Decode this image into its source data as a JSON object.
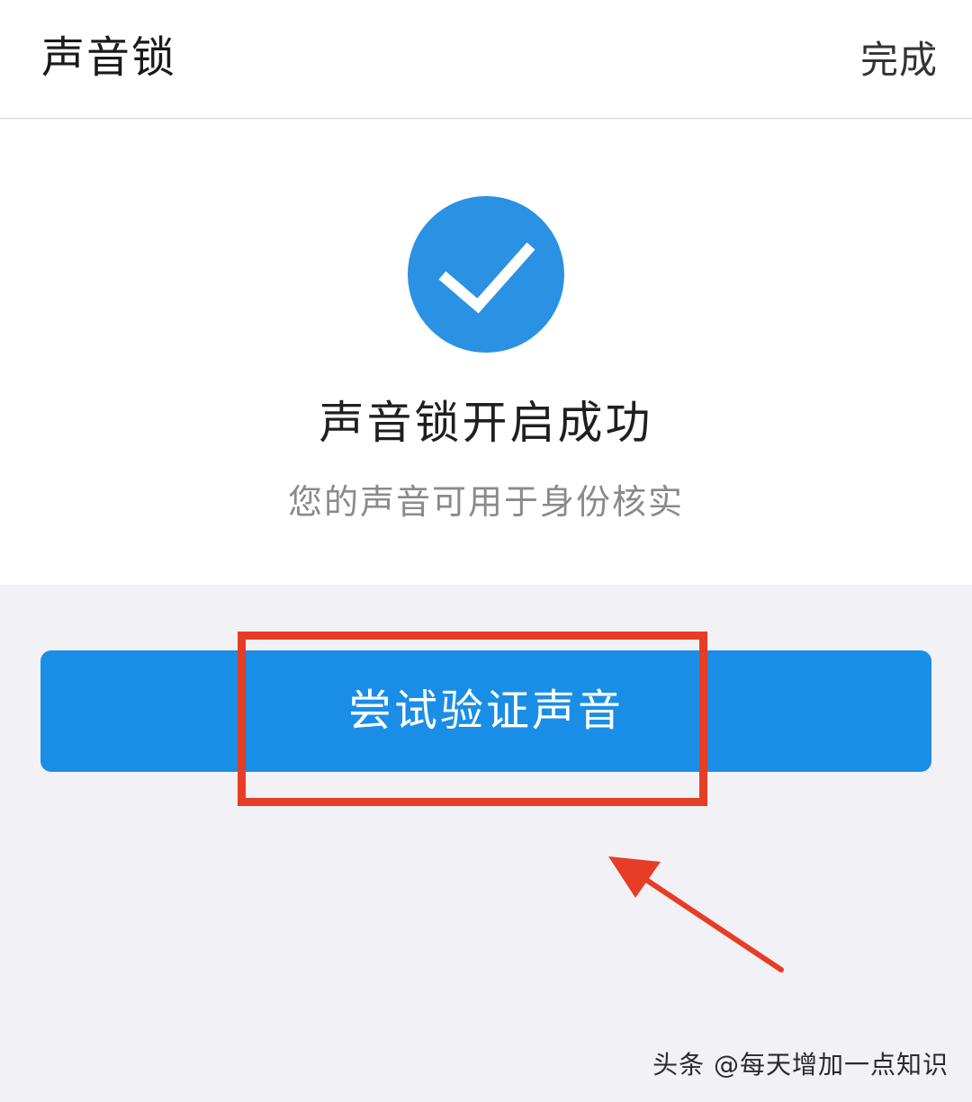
{
  "header": {
    "title": "声音锁",
    "done_label": "完成"
  },
  "result": {
    "icon": "check-circle-icon",
    "title": "声音锁开启成功",
    "description": "您的声音可用于身份核实"
  },
  "action": {
    "verify_label": "尝试验证声音"
  },
  "watermark": {
    "text": "头条 @每天增加一点知识"
  },
  "colors": {
    "accent": "#1a8ee6",
    "annotation": "#e73c26",
    "background": "#f2f2f6"
  }
}
